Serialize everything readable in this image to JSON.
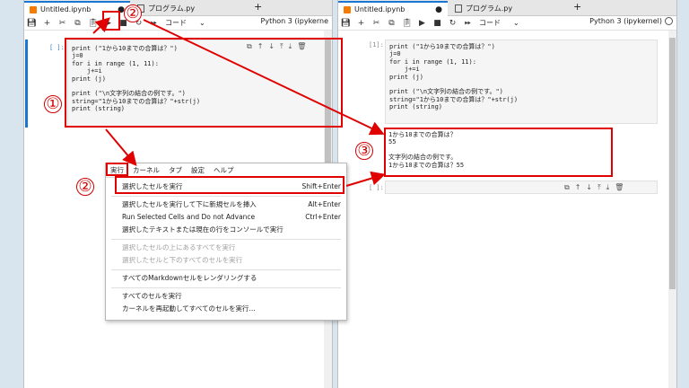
{
  "left_pane": {
    "tabs": [
      {
        "label": "Untitled.ipynb",
        "icon": "notebook-icon",
        "dirty": "●"
      },
      {
        "label": "プログラム.py",
        "icon": "file-icon"
      }
    ],
    "add_tab": "+",
    "toolbar": {
      "cell_type": "コード",
      "kernel": "Python 3 (ipykerne"
    },
    "cell": {
      "prompt": "[ ]:",
      "lines": [
        "print (\"1から10までの合算は？\")",
        "j=0",
        "for i in range (1, 11):",
        "    j+=i",
        "print (j)",
        "",
        "print (\"\\n文字列の結合の例です。\")",
        "string=\"1から10までの合算は？\"+str(j)",
        "print (string)"
      ]
    }
  },
  "right_pane": {
    "tabs": [
      {
        "label": "Untitled.ipynb",
        "icon": "notebook-icon",
        "dirty": "●"
      },
      {
        "label": "プログラム.py",
        "icon": "file-icon"
      }
    ],
    "add_tab": "+",
    "toolbar": {
      "cell_type": "コード",
      "kernel": "Python 3 (ipykernel)"
    },
    "cell": {
      "prompt": "[1]:",
      "lines": [
        "print (\"1から10までの合算は？\")",
        "j=0",
        "for i in range (1, 11):",
        "    j+=i",
        "print (j)",
        "",
        "print (\"\\n文字列の結合の例です。\")",
        "string=\"1から10までの合算は？\"+str(j)",
        "print (string)"
      ]
    },
    "output_lines": [
      "1から10までの合算は？",
      "55",
      "",
      "文字列の結合の例です。",
      "1から10までの合算は？55"
    ],
    "empty_cell_prompt": "[ ]:"
  },
  "menu": {
    "bar": [
      "実行",
      "カーネル",
      "タブ",
      "設定",
      "ヘルプ"
    ],
    "items": [
      {
        "label": "選択したセルを実行",
        "shortcut": "Shift+Enter",
        "enabled": true
      },
      {
        "label": "選択したセルを実行して下に新規セルを挿入",
        "shortcut": "Alt+Enter",
        "enabled": true
      },
      {
        "label": "Run Selected Cells and Do not Advance",
        "shortcut": "Ctrl+Enter",
        "enabled": true
      },
      {
        "label": "選択したテキストまたは現在の行をコンソールで実行",
        "shortcut": "",
        "enabled": true
      },
      {
        "label": "選択したセルの上にあるすべてを実行",
        "shortcut": "",
        "enabled": false
      },
      {
        "label": "選択したセルと下のすべてのセルを実行",
        "shortcut": "",
        "enabled": false
      },
      {
        "label": "すべてのMarkdownセルをレンダリングする",
        "shortcut": "",
        "enabled": true
      },
      {
        "label": "すべてのセルを実行",
        "shortcut": "",
        "enabled": true
      },
      {
        "label": "カーネルを再起動してすべてのセルを実行...",
        "shortcut": "",
        "enabled": true
      }
    ]
  },
  "callouts": {
    "one": "①",
    "two_top": "②",
    "two_menu": "②",
    "three": "③"
  },
  "annotation_color": "#e00000"
}
